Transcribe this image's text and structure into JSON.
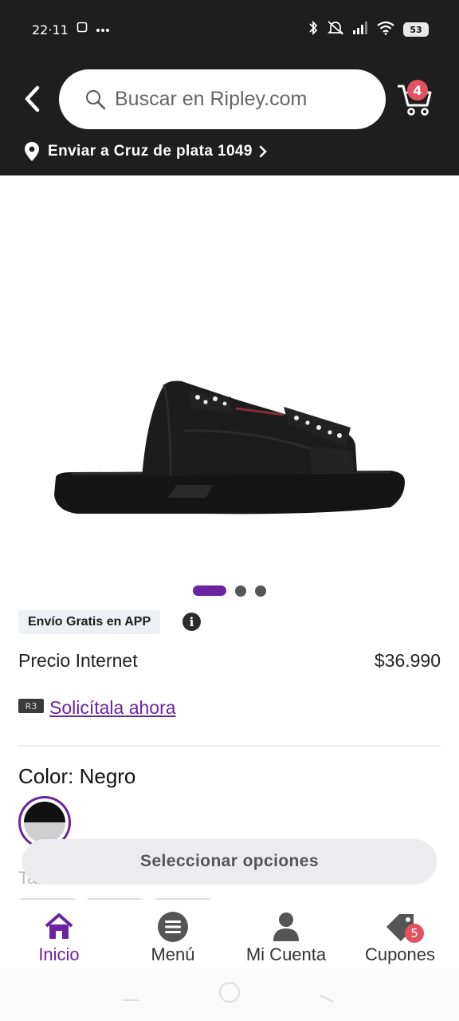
{
  "status_bar": {
    "time": "22",
    "time_full": "22·11",
    "battery": "53",
    "icons": [
      "paw-icon",
      "screen-record-icon",
      "more-dots-icon",
      "bluetooth-icon",
      "mute-icon",
      "signal-icon",
      "wifi-icon",
      "battery-icon"
    ]
  },
  "header": {
    "back_icon": "back-chevron-icon",
    "search_placeholder": "Buscar en Ripley.com",
    "cart_count": "4",
    "address_label": "Enviar a Cruz de plata 1049"
  },
  "product": {
    "image_alt": "black-slide-sandal",
    "carousel": {
      "total": 3,
      "active": 1
    },
    "shipping_tag": "Envío Gratis en APP",
    "price_label": "Precio Internet",
    "price_value": "$36.990",
    "card_logo": "R3",
    "apply_link": "Solicítala ahora",
    "color_label": "Color: Negro",
    "size_label": "Talla:"
  },
  "floating_button": {
    "label": "Seleccionar opciones"
  },
  "bottom_nav": {
    "items": [
      {
        "label": "Inicio",
        "icon": "home-icon",
        "active": true
      },
      {
        "label": "Menú",
        "icon": "menu-icon",
        "active": false
      },
      {
        "label": "Mi Cuenta",
        "icon": "user-icon",
        "active": false
      },
      {
        "label": "Cupones",
        "icon": "coupon-tag-icon",
        "active": false,
        "badge": "5"
      }
    ]
  },
  "colors": {
    "brand_purple": "#6b23a0",
    "badge_red": "#e0535f",
    "header_bg": "#1e1e1e"
  }
}
